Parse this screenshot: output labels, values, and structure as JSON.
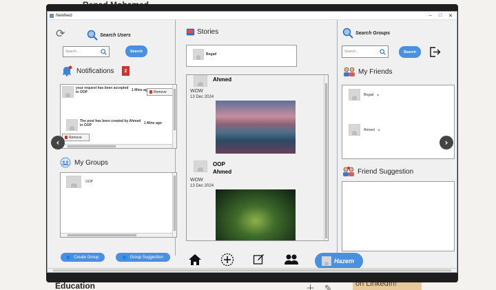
{
  "background": {
    "top_text": "Repad Mohamed",
    "bottom_text": "Education",
    "linkedin_text": "on LinkedIn!"
  },
  "window": {
    "title": "Newfeed"
  },
  "left": {
    "search_label": "Search Users",
    "search_placeholder": "Search...",
    "search_button": "Search",
    "notifications_title": "Notifications",
    "notifications_count": "2",
    "notifications": [
      {
        "text": "your request has been accepted in OOP",
        "time": "1 Mins ago",
        "remove_label": "Remove"
      },
      {
        "text": "The post has been created by Ahmed in OOP",
        "time": "1 Mins ago",
        "remove_label": "Remove"
      }
    ],
    "groups_title": "My Groups",
    "groups": [
      {
        "name": "OOP"
      }
    ],
    "create_group_label": "Create Group",
    "group_suggestion_label": "Group Suggestion"
  },
  "center": {
    "stories_title": "Stories",
    "stories": [
      {
        "name": "Begad"
      }
    ],
    "posts": [
      {
        "group": "",
        "author": "Ahmed",
        "text": "WOW",
        "date": "13 Dec 2024"
      },
      {
        "group": "OOP",
        "author": "Ahmed",
        "text": "WOW",
        "date": "13 Dec 2024"
      }
    ]
  },
  "right": {
    "search_label": "Search Groups",
    "search_placeholder": "Search...",
    "search_button": "Search",
    "friends_title": "My Friends",
    "friends": [
      {
        "name": "Begad",
        "status": "●"
      },
      {
        "name": "Ahmed",
        "status": "●"
      }
    ],
    "suggestion_title": "Friend Suggestion"
  },
  "bottom": {
    "user_name": "Hazem"
  },
  "colors": {
    "accent": "#4a90e2",
    "badge": "#d32f2f",
    "window_bg": "#f0f0f0"
  }
}
